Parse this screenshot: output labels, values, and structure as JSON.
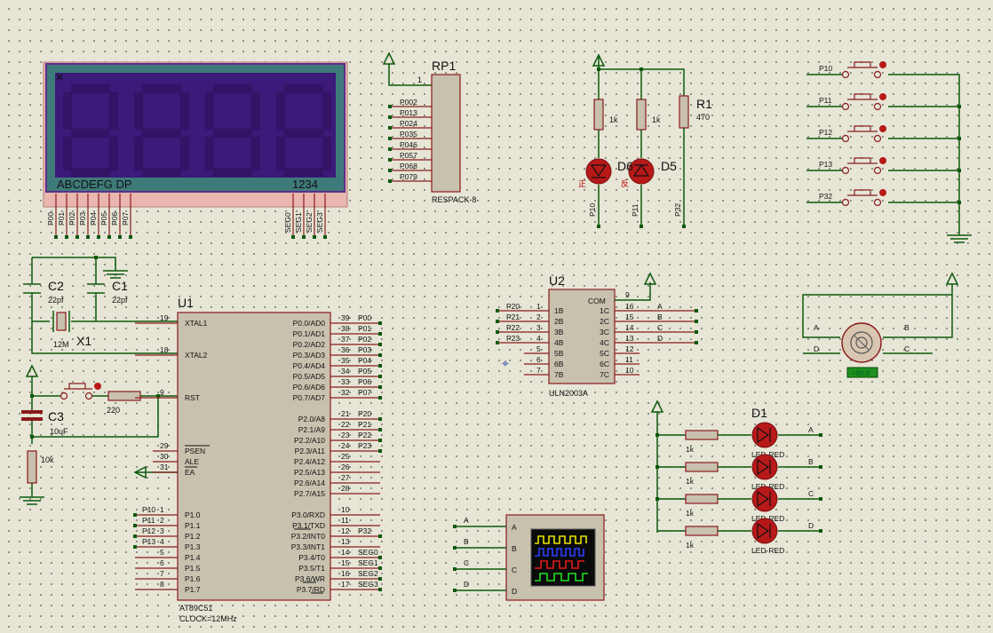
{
  "display": {
    "bottom_left": "ABCDEFG  DP",
    "bottom_right": "1234",
    "seg_pins": [
      "P00",
      "P01",
      "P02",
      "P03",
      "P04",
      "P05",
      "P06",
      "P07"
    ],
    "digit_pins": [
      "SEG0",
      "SEG1",
      "SEG2",
      "SEG3"
    ]
  },
  "rp1": {
    "ref": "RP1",
    "type": "RESPACK-8",
    "pin1": "1",
    "pins": [
      "P002",
      "P013",
      "P024",
      "P035",
      "P046",
      "P057",
      "P068",
      "P079"
    ]
  },
  "leds_top": {
    "r_left": "1k",
    "r_mid": "1k",
    "r1_ref": "R1",
    "r1_val": "470",
    "d_left_ref": "D6",
    "d_right_ref": "D5",
    "zheng": "正",
    "fan": "反",
    "nets": [
      "P10",
      "P11",
      "P32"
    ]
  },
  "buttons": [
    "P10",
    "P11",
    "P12",
    "P13",
    "P32"
  ],
  "caps": {
    "c2": "C2",
    "c2_val": "22pf",
    "c1": "C1",
    "c1_val": "22pf",
    "x1": "X1",
    "x1_val": "12M"
  },
  "reset": {
    "c3": "C3",
    "c3_val": "10uF",
    "r_val": "220",
    "r10k": "10k"
  },
  "u1": {
    "ref": "U1",
    "type": "AT89C51",
    "clock": "CLOCK=12MHz",
    "left_pins": [
      {
        "num": "19",
        "name": "XTAL1"
      },
      {
        "num": "18",
        "name": "XTAL2"
      },
      {
        "num": "9",
        "name": "RST"
      },
      {
        "num": "29",
        "name": "PSEN"
      },
      {
        "num": "30",
        "name": "ALE"
      },
      {
        "num": "31",
        "name": "EA"
      },
      {
        "num": "1",
        "name": "P1.0"
      },
      {
        "num": "2",
        "name": "P1.1"
      },
      {
        "num": "3",
        "name": "P1.2"
      },
      {
        "num": "4",
        "name": "P1.3"
      },
      {
        "num": "5",
        "name": "P1.4"
      },
      {
        "num": "6",
        "name": "P1.5"
      },
      {
        "num": "7",
        "name": "P1.6"
      },
      {
        "num": "8",
        "name": "P1.7"
      }
    ],
    "right_pins": [
      {
        "num": "39",
        "name": "P0.0/AD0",
        "net": "P00"
      },
      {
        "num": "38",
        "name": "P0.1/AD1",
        "net": "P01"
      },
      {
        "num": "37",
        "name": "P0.2/AD2",
        "net": "P02"
      },
      {
        "num": "36",
        "name": "P0.3/AD3",
        "net": "P03"
      },
      {
        "num": "35",
        "name": "P0.4/AD4",
        "net": "P04"
      },
      {
        "num": "34",
        "name": "P0.5/AD5",
        "net": "P05"
      },
      {
        "num": "33",
        "name": "P0.6/AD6",
        "net": "P06"
      },
      {
        "num": "32",
        "name": "P0.7/AD7",
        "net": "P07"
      },
      {
        "num": "21",
        "name": "P2.0/A8",
        "net": "P20"
      },
      {
        "num": "22",
        "name": "P2.1/A9",
        "net": "P21"
      },
      {
        "num": "23",
        "name": "P2.2/A10",
        "net": "P22"
      },
      {
        "num": "24",
        "name": "P2.3/A11",
        "net": "P23"
      },
      {
        "num": "25",
        "name": "P2.4/A12",
        "net": ""
      },
      {
        "num": "26",
        "name": "P2.5/A13",
        "net": ""
      },
      {
        "num": "27",
        "name": "P2.6/A14",
        "net": ""
      },
      {
        "num": "28",
        "name": "P2.7/A15",
        "net": ""
      },
      {
        "num": "10",
        "name": "P3.0/RXD",
        "net": ""
      },
      {
        "num": "11",
        "name": "P3.1/TXD",
        "net": ""
      },
      {
        "num": "12",
        "name": "P3.2/INT0",
        "net": "P32"
      },
      {
        "num": "13",
        "name": "P3.3/INT1",
        "net": ""
      },
      {
        "num": "14",
        "name": "P3.4/T0",
        "net": "SEG0"
      },
      {
        "num": "15",
        "name": "P3.5/T1",
        "net": "SEG1"
      },
      {
        "num": "16",
        "name": "P3.6/WR",
        "net": "SEG2"
      },
      {
        "num": "17",
        "name": "P3.7/RD",
        "net": "SEG3"
      }
    ],
    "left_nets": [
      "P10",
      "P11",
      "P12",
      "P13"
    ]
  },
  "u2": {
    "ref": "U2",
    "type": "ULN2003A",
    "com": "COM",
    "com_num": "9",
    "inputs": [
      {
        "num": "1",
        "name": "1B",
        "net": "P20"
      },
      {
        "num": "2",
        "name": "2B",
        "net": "P21"
      },
      {
        "num": "3",
        "name": "3B",
        "net": "P22"
      },
      {
        "num": "4",
        "name": "4B",
        "net": "P23"
      },
      {
        "num": "5",
        "name": "5B",
        "net": ""
      },
      {
        "num": "6",
        "name": "6B",
        "net": ""
      },
      {
        "num": "7",
        "name": "7B",
        "net": ""
      }
    ],
    "outputs": [
      {
        "num": "16",
        "name": "1C",
        "net": "A"
      },
      {
        "num": "15",
        "name": "2C",
        "net": "B"
      },
      {
        "num": "14",
        "name": "3C",
        "net": "C"
      },
      {
        "num": "13",
        "name": "4C",
        "net": "D"
      },
      {
        "num": "12",
        "name": "5C",
        "net": ""
      },
      {
        "num": "11",
        "name": "6C",
        "net": ""
      },
      {
        "num": "10",
        "name": "7C",
        "net": ""
      }
    ]
  },
  "motor": {
    "labels": [
      "A",
      "B",
      "D",
      "C"
    ],
    "value": "+88.8"
  },
  "d1": {
    "ref": "D1",
    "res": "1k",
    "led": "LED-RED",
    "nets": [
      "A",
      "B",
      "C",
      "D"
    ]
  },
  "scope": {
    "channels": [
      "A",
      "B",
      "C",
      "D"
    ],
    "nets": [
      "A",
      "B",
      "C",
      "D"
    ]
  },
  "colors": {
    "wire": "#0c5a0c",
    "component": "#8b1a1a",
    "body": "#c7c1ae",
    "lcd_glass": "#3b1a7a",
    "lcd_frame": "#3f7a7a"
  }
}
